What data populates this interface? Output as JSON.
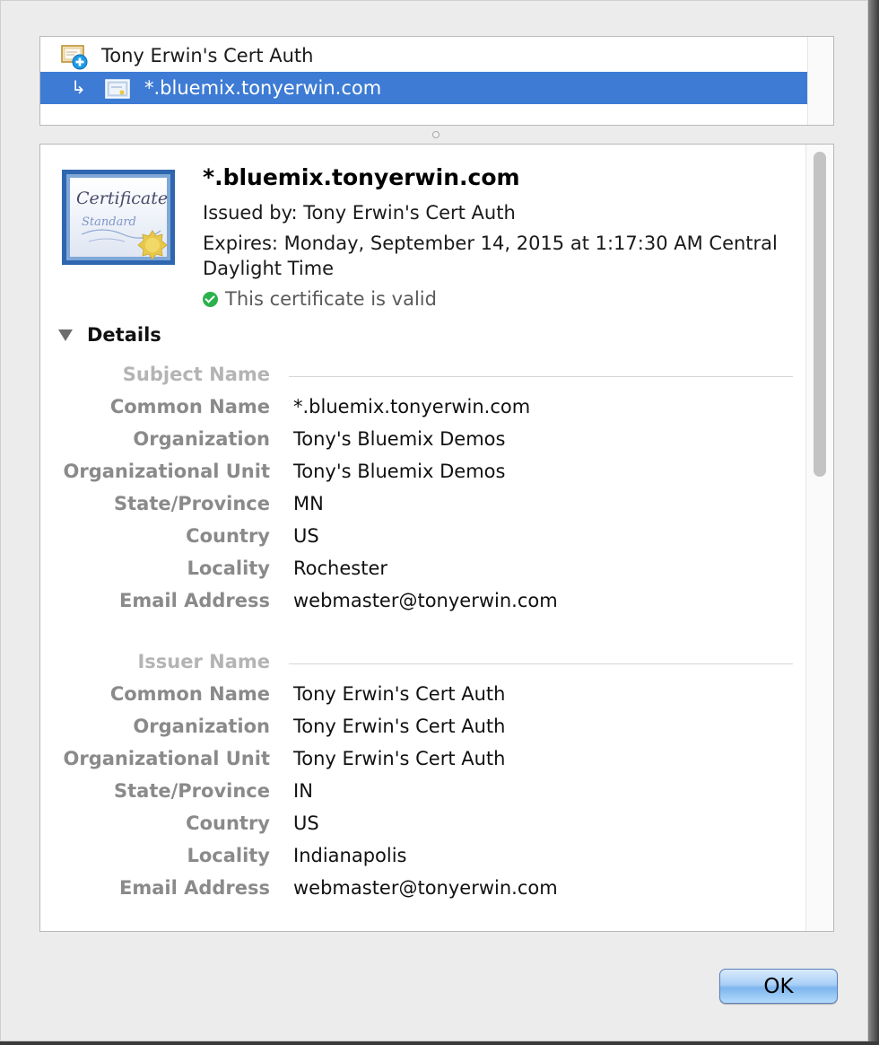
{
  "tree": {
    "items": [
      {
        "label": "Tony Erwin's Cert Auth",
        "icon": "certificate-authority-icon",
        "selected": false
      },
      {
        "label": "*.bluemix.tonyerwin.com",
        "icon": "certificate-icon",
        "selected": true,
        "prefix": "↳"
      }
    ]
  },
  "certificate": {
    "name": "*.bluemix.tonyerwin.com",
    "issued_by": "Issued by: Tony Erwin's Cert Auth",
    "expires": "Expires: Monday, September 14, 2015 at 1:17:30 AM Central Daylight Time",
    "validity": "This certificate is valid",
    "image_text_1": "Certificate",
    "image_text_2": "Standard"
  },
  "details": {
    "label": "Details",
    "subject": {
      "heading": "Subject Name",
      "rows": [
        {
          "key": "Common Name",
          "value": "*.bluemix.tonyerwin.com"
        },
        {
          "key": "Organization",
          "value": "Tony's Bluemix Demos"
        },
        {
          "key": "Organizational Unit",
          "value": "Tony's Bluemix Demos"
        },
        {
          "key": "State/Province",
          "value": "MN"
        },
        {
          "key": "Country",
          "value": "US"
        },
        {
          "key": "Locality",
          "value": "Rochester"
        },
        {
          "key": "Email Address",
          "value": "webmaster@tonyerwin.com"
        }
      ]
    },
    "issuer": {
      "heading": "Issuer Name",
      "rows": [
        {
          "key": "Common Name",
          "value": "Tony Erwin's Cert Auth"
        },
        {
          "key": "Organization",
          "value": "Tony Erwin's Cert Auth"
        },
        {
          "key": "Organizational Unit",
          "value": "Tony Erwin's Cert Auth"
        },
        {
          "key": "State/Province",
          "value": "IN"
        },
        {
          "key": "Country",
          "value": "US"
        },
        {
          "key": "Locality",
          "value": "Indianapolis"
        },
        {
          "key": "Email Address",
          "value": "webmaster@tonyerwin.com"
        }
      ]
    }
  },
  "buttons": {
    "ok_label": "OK"
  },
  "colors": {
    "selection": "#3d7bd4",
    "valid": "#2bb24c",
    "ok_button": "#a9cff5"
  }
}
